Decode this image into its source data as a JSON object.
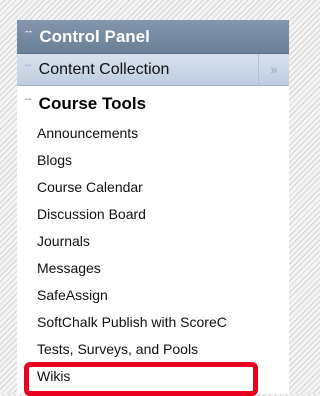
{
  "control_panel": {
    "title": "Control Panel",
    "collapse_icon": "double-chevron-up-icon"
  },
  "content_collection": {
    "label": "Content Collection",
    "collapsed_icon": "double-chevron-down-icon",
    "expand_icon": "double-chevron-right-icon"
  },
  "course_tools": {
    "title": "Course Tools",
    "collapse_icon": "double-chevron-up-icon",
    "items": [
      {
        "label": "Announcements"
      },
      {
        "label": "Blogs"
      },
      {
        "label": "Course Calendar"
      },
      {
        "label": "Discussion Board"
      },
      {
        "label": "Journals"
      },
      {
        "label": "Messages"
      },
      {
        "label": "SafeAssign"
      },
      {
        "label": "SoftChalk Publish with ScoreC"
      },
      {
        "label": "Tests, Surveys, and Pools"
      },
      {
        "label": "Wikis"
      }
    ]
  },
  "highlight": {
    "target": "Wikis",
    "color": "#e8001c"
  },
  "colors": {
    "header_bg": "#7489a3",
    "sub_header_bg": "#c9d5e6"
  }
}
